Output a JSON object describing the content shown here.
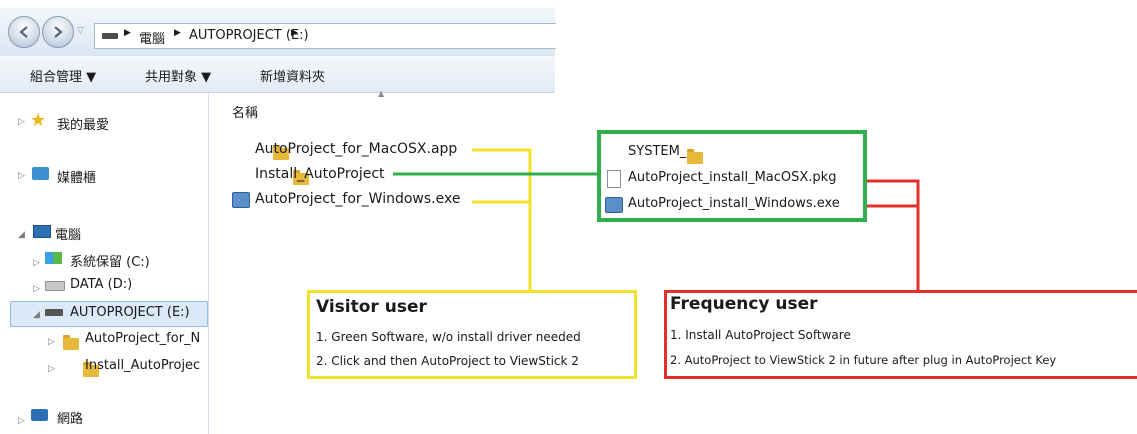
{
  "address": {
    "crumbs": [
      "電腦",
      "AUTOPROJECT (E:)"
    ]
  },
  "toolbar": {
    "organize": "組合管理 ▼",
    "share": "共用對象 ▼",
    "new_folder": "新增資料夾"
  },
  "column_header": "名稱",
  "nav": {
    "favorites": "我的最愛",
    "libraries": "媒體櫃",
    "computer": "電腦",
    "drive_c": "系統保留 (C:)",
    "drive_d": "DATA (D:)",
    "drive_e": "AUTOPROJECT (E:)",
    "sub1": "AutoProject_for_N",
    "sub2": "Install_AutoProjec",
    "network": "網路"
  },
  "files": [
    "AutoProject_for_MacOSX.app",
    "Install_AutoProject",
    "AutoProject_for_Windows.exe"
  ],
  "install_files": [
    "SYSTEM_",
    "AutoProject_install_MacOSX.pkg",
    "AutoProject_install_Windows.exe"
  ],
  "visitor": {
    "title": "Visitor user",
    "lines": [
      "1. Green Software, w/o install driver needed",
      "2. Click and then AutoProject to ViewStick 2"
    ]
  },
  "frequency": {
    "title": "Frequency user",
    "lines": [
      "1. Install AutoProject Software",
      "2. AutoProject to ViewStick 2 in future after plug in AutoProject Key"
    ]
  },
  "colors": {
    "yellow": "#f1e22a",
    "green": "#2fae4b",
    "red": "#e0302b"
  }
}
